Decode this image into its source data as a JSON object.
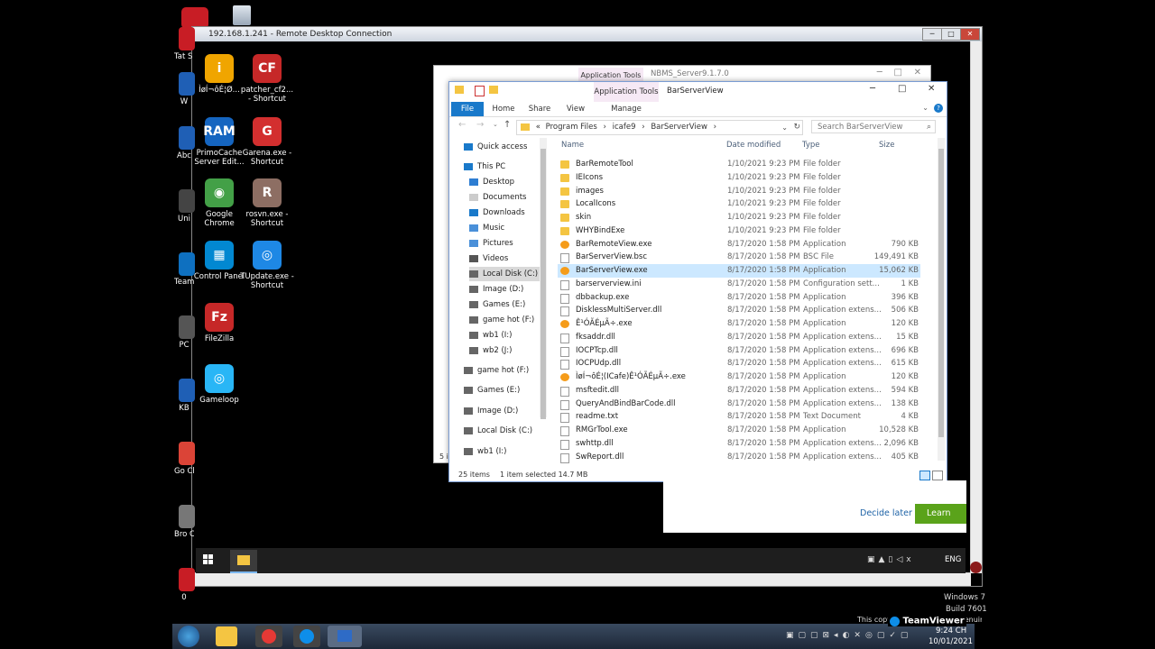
{
  "rdp": {
    "title": "192.168.1.241 - Remote Desktop Connection"
  },
  "desktop_left": {
    "items": [
      {
        "label": "Tat S Shor",
        "color": "#c81d25"
      },
      {
        "label": "W",
        "color": "#1f5fb5"
      },
      {
        "label": "Abc",
        "color": "#1f5fb5"
      },
      {
        "label": "Uni",
        "color": "#444"
      },
      {
        "label": "Team",
        "color": "#0e70c0"
      },
      {
        "label": "PC",
        "color": "#555"
      },
      {
        "label": "KB",
        "color": "#1f5fb5"
      },
      {
        "label": "Go Chr",
        "color": "#db4437"
      },
      {
        "label": "Bro Cre",
        "color": "#777"
      },
      {
        "label": "0",
        "color": "#c81d25"
      }
    ]
  },
  "desktop_icons": [
    {
      "label": "ÌøÍ¬ôÉ¦Ø...",
      "color": "#f0a500",
      "glyph": "i"
    },
    {
      "label": "patcher_cf2... - Shortcut",
      "color": "#c62828",
      "glyph": "CF"
    },
    {
      "label": "PrimoCache Server Edit...",
      "color": "#1565c0",
      "glyph": "RAM"
    },
    {
      "label": "Garena.exe - Shortcut",
      "color": "#d32f2f",
      "glyph": "G"
    },
    {
      "label": "Google Chrome",
      "color": "#43a047",
      "glyph": "◉"
    },
    {
      "label": "rosvn.exe - Shortcut",
      "color": "#8d6e63",
      "glyph": "R"
    },
    {
      "label": "Control Panel",
      "color": "#0288d1",
      "glyph": "▦"
    },
    {
      "label": "TUpdate.exe - Shortcut",
      "color": "#1e88e5",
      "glyph": "◎"
    },
    {
      "label": "FileZilla",
      "color": "#c62828",
      "glyph": "Fz"
    },
    {
      "label": "Gameloop",
      "color": "#29b6f6",
      "glyph": "◎"
    }
  ],
  "bg_window": {
    "tab": "Application Tools",
    "title": "NBMS_Server9.1.7.0",
    "status_fragment": "5 i"
  },
  "explorer": {
    "ribbon_app_tools": "Application Tools",
    "title": "BarServerView",
    "tabs": [
      "File",
      "Home",
      "Share",
      "View",
      "Manage"
    ],
    "breadcrumb": [
      "«",
      "Program Files",
      "›",
      "icafe9",
      "›",
      "BarServerView",
      "›"
    ],
    "search_placeholder": "Search BarServerView",
    "nav": [
      {
        "label": "Quick access",
        "level": 0
      },
      {
        "label": "This PC",
        "level": 0
      },
      {
        "label": "Desktop",
        "level": 1
      },
      {
        "label": "Documents",
        "level": 1
      },
      {
        "label": "Downloads",
        "level": 1
      },
      {
        "label": "Music",
        "level": 1
      },
      {
        "label": "Pictures",
        "level": 1
      },
      {
        "label": "Videos",
        "level": 1
      },
      {
        "label": "Local Disk (C:)",
        "level": 1,
        "selected": true
      },
      {
        "label": "Image (D:)",
        "level": 1
      },
      {
        "label": "Games (E:)",
        "level": 1
      },
      {
        "label": "game hot (F:)",
        "level": 1
      },
      {
        "label": "wb1 (I:)",
        "level": 1
      },
      {
        "label": "wb2 (J:)",
        "level": 1
      },
      {
        "label": "game hot (F:)",
        "level": 0
      },
      {
        "label": "Games (E:)",
        "level": 0
      },
      {
        "label": "Image (D:)",
        "level": 0
      },
      {
        "label": "Local Disk (C:)",
        "level": 0
      },
      {
        "label": "wb1 (I:)",
        "level": 0
      }
    ],
    "columns": [
      "Name",
      "Date modified",
      "Type",
      "Size"
    ],
    "files": [
      {
        "name": "BarRemoteTool",
        "date": "1/10/2021 9:23 PM",
        "type": "File folder",
        "size": "",
        "kind": "folder"
      },
      {
        "name": "IEIcons",
        "date": "1/10/2021 9:23 PM",
        "type": "File folder",
        "size": "",
        "kind": "folder"
      },
      {
        "name": "images",
        "date": "1/10/2021 9:23 PM",
        "type": "File folder",
        "size": "",
        "kind": "folder"
      },
      {
        "name": "LocalIcons",
        "date": "1/10/2021 9:23 PM",
        "type": "File folder",
        "size": "",
        "kind": "folder"
      },
      {
        "name": "skin",
        "date": "1/10/2021 9:23 PM",
        "type": "File folder",
        "size": "",
        "kind": "folder"
      },
      {
        "name": "WHYBindExe",
        "date": "1/10/2021 9:23 PM",
        "type": "File folder",
        "size": "",
        "kind": "folder"
      },
      {
        "name": "BarRemoteView.exe",
        "date": "8/17/2020 1:58 PM",
        "type": "Application",
        "size": "790 KB",
        "kind": "app"
      },
      {
        "name": "BarServerView.bsc",
        "date": "8/17/2020 1:58 PM",
        "type": "BSC File",
        "size": "149,491 KB",
        "kind": "file"
      },
      {
        "name": "BarServerView.exe",
        "date": "8/17/2020 1:58 PM",
        "type": "Application",
        "size": "15,062 KB",
        "kind": "app",
        "selected": true
      },
      {
        "name": "barserverview.ini",
        "date": "8/17/2020 1:58 PM",
        "type": "Configuration sett...",
        "size": "1 KB",
        "kind": "file"
      },
      {
        "name": "dbbackup.exe",
        "date": "8/17/2020 1:58 PM",
        "type": "Application",
        "size": "396 KB",
        "kind": "file"
      },
      {
        "name": "DisklessMultiServer.dll",
        "date": "8/17/2020 1:58 PM",
        "type": "Application extens...",
        "size": "506 KB",
        "kind": "file"
      },
      {
        "name": "Ê¹ÓÃÉµÃ÷.exe",
        "date": "8/17/2020 1:58 PM",
        "type": "Application",
        "size": "120 KB",
        "kind": "app"
      },
      {
        "name": "fksaddr.dll",
        "date": "8/17/2020 1:58 PM",
        "type": "Application extens...",
        "size": "15 KB",
        "kind": "file"
      },
      {
        "name": "IOCPTcp.dll",
        "date": "8/17/2020 1:58 PM",
        "type": "Application extens...",
        "size": "696 KB",
        "kind": "file"
      },
      {
        "name": "IOCPUdp.dll",
        "date": "8/17/2020 1:58 PM",
        "type": "Application extens...",
        "size": "615 KB",
        "kind": "file"
      },
      {
        "name": "ÌøÍ¬ôÉ¦(ICafe)Ê¹ÓÃÉµÃ÷.exe",
        "date": "8/17/2020 1:58 PM",
        "type": "Application",
        "size": "120 KB",
        "kind": "app"
      },
      {
        "name": "msftedit.dll",
        "date": "8/17/2020 1:58 PM",
        "type": "Application extens...",
        "size": "594 KB",
        "kind": "file"
      },
      {
        "name": "QueryAndBindBarCode.dll",
        "date": "8/17/2020 1:58 PM",
        "type": "Application extens...",
        "size": "138 KB",
        "kind": "file"
      },
      {
        "name": "readme.txt",
        "date": "8/17/2020 1:58 PM",
        "type": "Text Document",
        "size": "4 KB",
        "kind": "file"
      },
      {
        "name": "RMGrTool.exe",
        "date": "8/17/2020 1:58 PM",
        "type": "Application",
        "size": "10,528 KB",
        "kind": "file"
      },
      {
        "name": "swhttp.dll",
        "date": "8/17/2020 1:58 PM",
        "type": "Application extens...",
        "size": "2,096 KB",
        "kind": "file"
      },
      {
        "name": "SwReport.dll",
        "date": "8/17/2020 1:58 PM",
        "type": "Application extens...",
        "size": "405 KB",
        "kind": "file"
      }
    ],
    "status_items": "25 items",
    "status_selected": "1 item selected  14.7 MB"
  },
  "popup": {
    "decide_later": "Decide later",
    "learn_more": "Learn mo"
  },
  "inner_tray": {
    "lang": "ENG"
  },
  "outer": {
    "win_line1": "Windows 7",
    "win_line2": "Build 7601",
    "copy": "This copy of Windows is not genuine",
    "teamviewer": "TeamViewer",
    "time": "9:24 CH",
    "date": "10/01/2021"
  }
}
